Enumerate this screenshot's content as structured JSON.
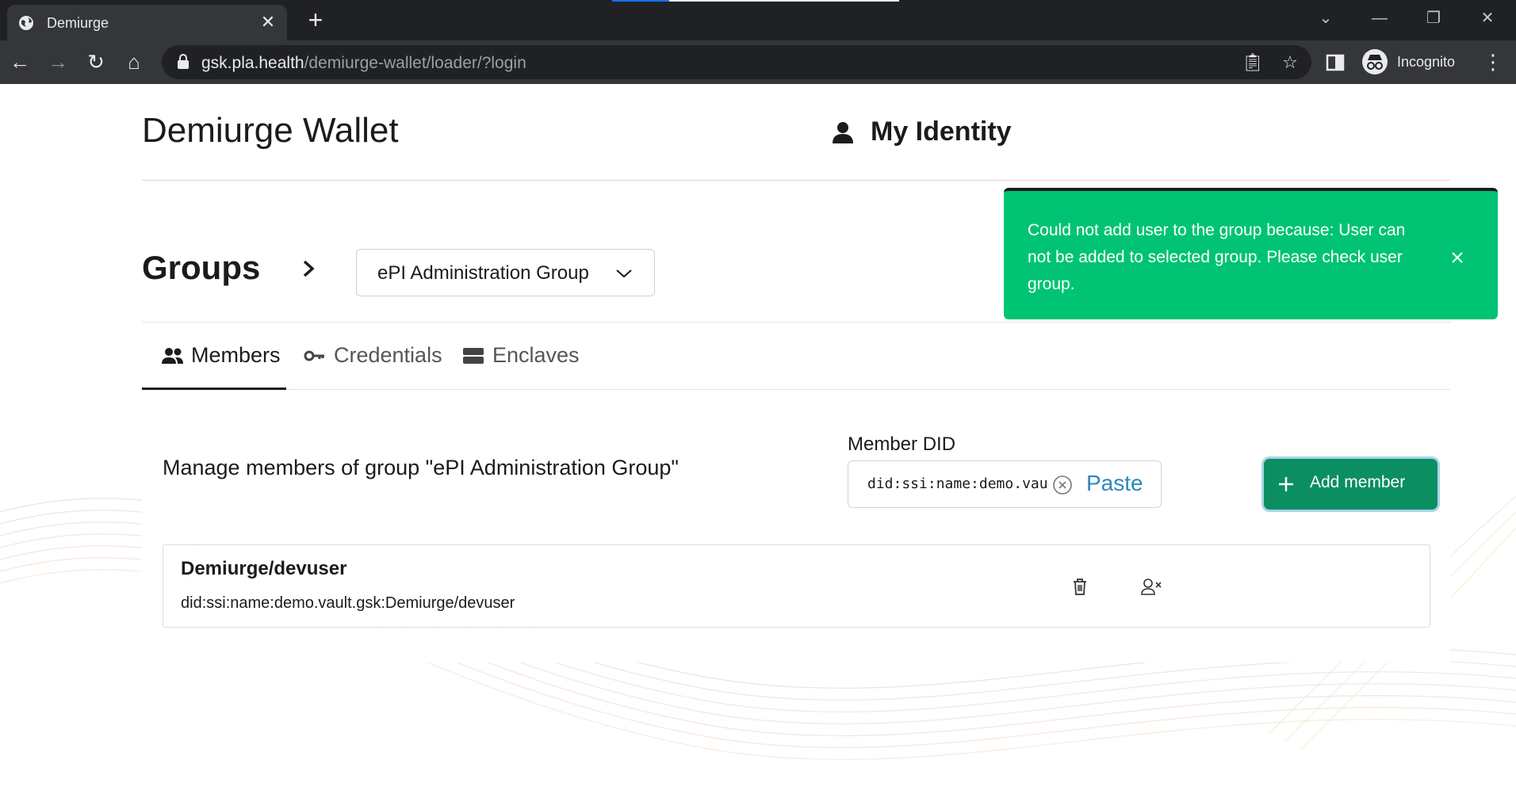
{
  "browser": {
    "tab_title": "Demiurge",
    "url_host": "gsk.pla.health",
    "url_path": "/demiurge-wallet/loader/?login",
    "profile_label": "Incognito"
  },
  "header": {
    "app_title": "Demiurge Wallet",
    "identity_label": "My Identity"
  },
  "groups": {
    "title": "Groups",
    "selected_group": "ePI Administration Group"
  },
  "tabs": [
    {
      "label": "Members"
    },
    {
      "label": "Credentials"
    },
    {
      "label": "Enclaves"
    }
  ],
  "members": {
    "manage_text": "Manage members of group \"ePI Administration Group\"",
    "did_label": "Member DID",
    "did_value": "did:ssi:name:demo.vault",
    "paste_label": "Paste",
    "add_label": "Add member",
    "list": [
      {
        "name": "Demiurge/devuser",
        "did": "did:ssi:name:demo.vault.gsk:Demiurge/devuser"
      }
    ]
  },
  "toast": {
    "message": "Could not add user to the group because: User can not be added to selected group. Please check user group."
  },
  "colors": {
    "accent": "#0b8f62",
    "toast": "#00c473",
    "paste": "#2a88bf"
  }
}
